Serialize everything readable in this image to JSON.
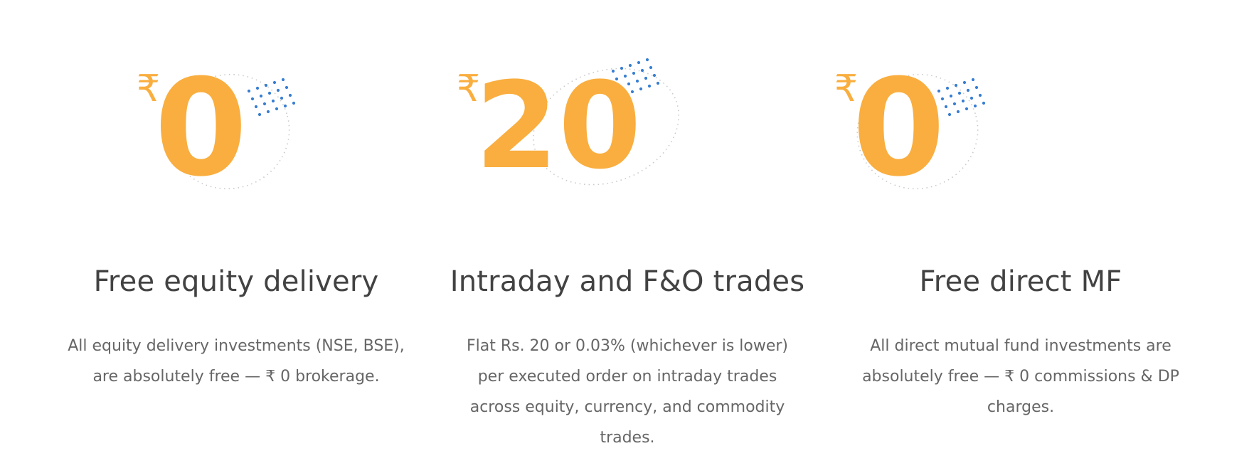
{
  "colors": {
    "accent": "#f9ae3f",
    "dots": "#387ed1",
    "outline": "#c9c9c9",
    "heading": "#424242",
    "body_text": "#666666"
  },
  "cards": [
    {
      "currency_symbol": "₹",
      "price": "0",
      "title": "Free equity delivery",
      "description": "All equity delivery investments (NSE, BSE), are absolutely free — ₹ 0 brokerage."
    },
    {
      "currency_symbol": "₹",
      "price": "20",
      "title": "Intraday and F&O trades",
      "description": "Flat Rs. 20 or 0.03% (whichever is lower) per executed order on intraday trades across equity, currency, and commodity trades."
    },
    {
      "currency_symbol": "₹",
      "price": "0",
      "title": "Free direct MF",
      "description": "All direct mutual fund investments are absolutely free — ₹ 0 commissions & DP charges."
    }
  ]
}
